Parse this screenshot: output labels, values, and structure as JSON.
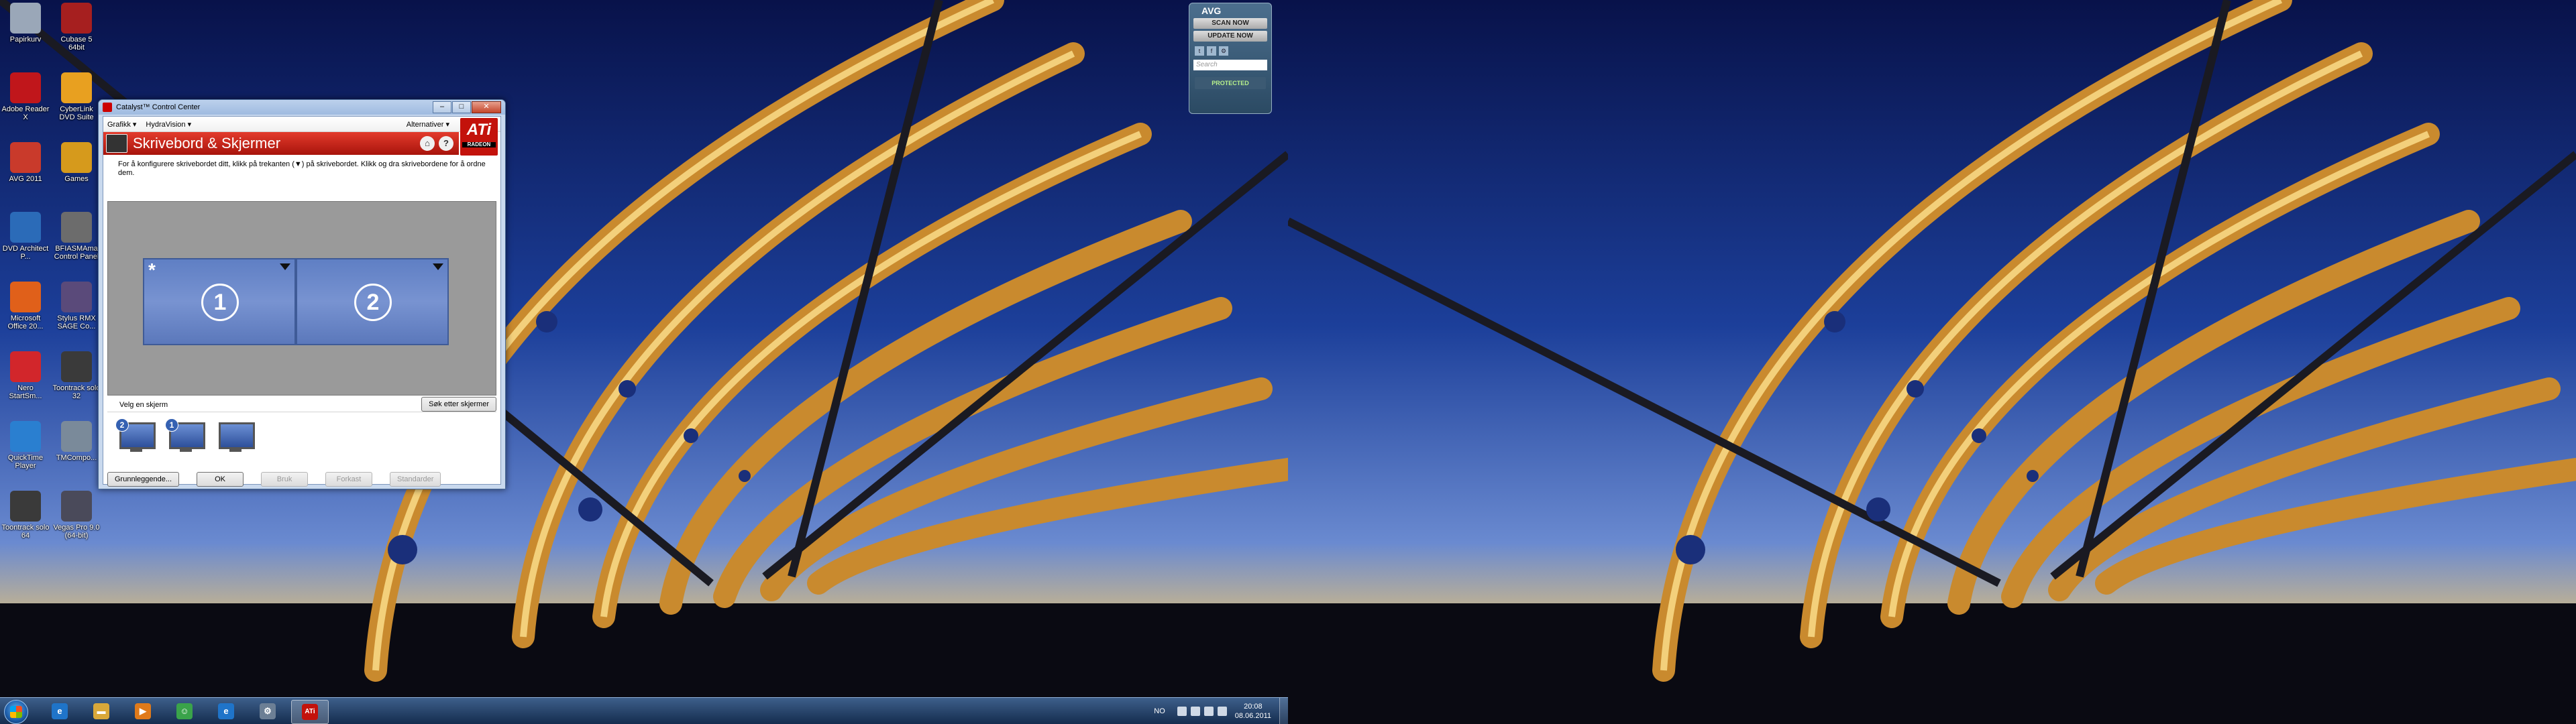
{
  "desktop_icons": [
    {
      "label": "Papirkurv",
      "icon": "recycle-bin-icon",
      "color": "#9aa7b8"
    },
    {
      "label": "Cubase 5 64bit",
      "icon": "cubase-icon",
      "color": "#a61f1f"
    },
    {
      "label": "Adobe Reader X",
      "icon": "adobe-reader-icon",
      "color": "#c0161b"
    },
    {
      "label": "CyberLink DVD Suite",
      "icon": "cyberlink-icon",
      "color": "#e8a020"
    },
    {
      "label": "AVG 2011",
      "icon": "avg-icon",
      "color": "#c93a2b"
    },
    {
      "label": "Games",
      "icon": "games-icon",
      "color": "#d69a1c"
    },
    {
      "label": "DVD Architect P...",
      "icon": "dvd-architect-icon",
      "color": "#2b6bb8"
    },
    {
      "label": "BFIASMAma Control Panel",
      "icon": "control-panel-icon",
      "color": "#6c6c6c"
    },
    {
      "label": "Microsoft Office 20...",
      "icon": "office-icon",
      "color": "#e0601a"
    },
    {
      "label": "Stylus RMX SAGE Co...",
      "icon": "stylus-rmx-icon",
      "color": "#5a4a7a"
    },
    {
      "label": "Nero StartSm...",
      "icon": "nero-icon",
      "color": "#d2262b"
    },
    {
      "label": "Toontrack solo 32",
      "icon": "toontrack-icon",
      "color": "#3a3a3a"
    },
    {
      "label": "QuickTime Player",
      "icon": "quicktime-icon",
      "color": "#2a7fd0"
    },
    {
      "label": "TMCompo...",
      "icon": "tm-icon",
      "color": "#7a8a9a"
    },
    {
      "label": "Toontrack solo 64",
      "icon": "toontrack-icon",
      "color": "#3a3a3a"
    },
    {
      "label": "Vegas Pro 9.0 (64-bit)",
      "icon": "vegas-icon",
      "color": "#4a4a5a"
    }
  ],
  "ccc": {
    "title": "Catalyst™ Control Center",
    "menu": {
      "grafikk": "Grafikk ▾",
      "hydravision": "HydraVision ▾",
      "alternativer": "Alternativer ▾"
    },
    "header": "Skrivebord & Skjermer",
    "ati_logo": "ATi",
    "ati_sub": "RADEON",
    "instruction": "For å konfigurere skrivebordet ditt, klikk på trekanten (▼) på skrivebordet.  Klikk og dra skrivebordene for å ordne dem.",
    "displays": [
      {
        "number": "1",
        "primary_mark": "*"
      },
      {
        "number": "2",
        "primary_mark": ""
      }
    ],
    "choose_label": "Velg en skjerm",
    "search_button": "Søk etter skjermer",
    "monitor_badges": [
      "2",
      "1",
      ""
    ],
    "buttons": {
      "basic": "Grunnleggende...",
      "ok": "OK",
      "apply": "Bruk",
      "discard": "Forkast",
      "defaults": "Standarder"
    }
  },
  "avg": {
    "brand": "AVG",
    "scan": "SCAN NOW",
    "update": "UPDATE NOW",
    "search_placeholder": "Search",
    "status": "PROTECTED"
  },
  "taskbar": {
    "language": "NO",
    "time": "20:08",
    "date": "08.06.2011",
    "pinned": [
      {
        "name": "ie-icon",
        "color": "#1f74c9",
        "glyph": "e"
      },
      {
        "name": "explorer-icon",
        "color": "#d9a83a",
        "glyph": "▬"
      },
      {
        "name": "media-player-icon",
        "color": "#e07a1a",
        "glyph": "▶"
      },
      {
        "name": "messenger-icon",
        "color": "#3aa34a",
        "glyph": "☺"
      },
      {
        "name": "ie-icon",
        "color": "#1f74c9",
        "glyph": "e"
      },
      {
        "name": "settings-icon",
        "color": "#6c7f95",
        "glyph": "⚙"
      },
      {
        "name": "ati-icon",
        "color": "#c3120b",
        "glyph": "ATi"
      }
    ]
  },
  "colors": {
    "ati_red": "#c3120b",
    "display_blue": "#6b88cc"
  }
}
